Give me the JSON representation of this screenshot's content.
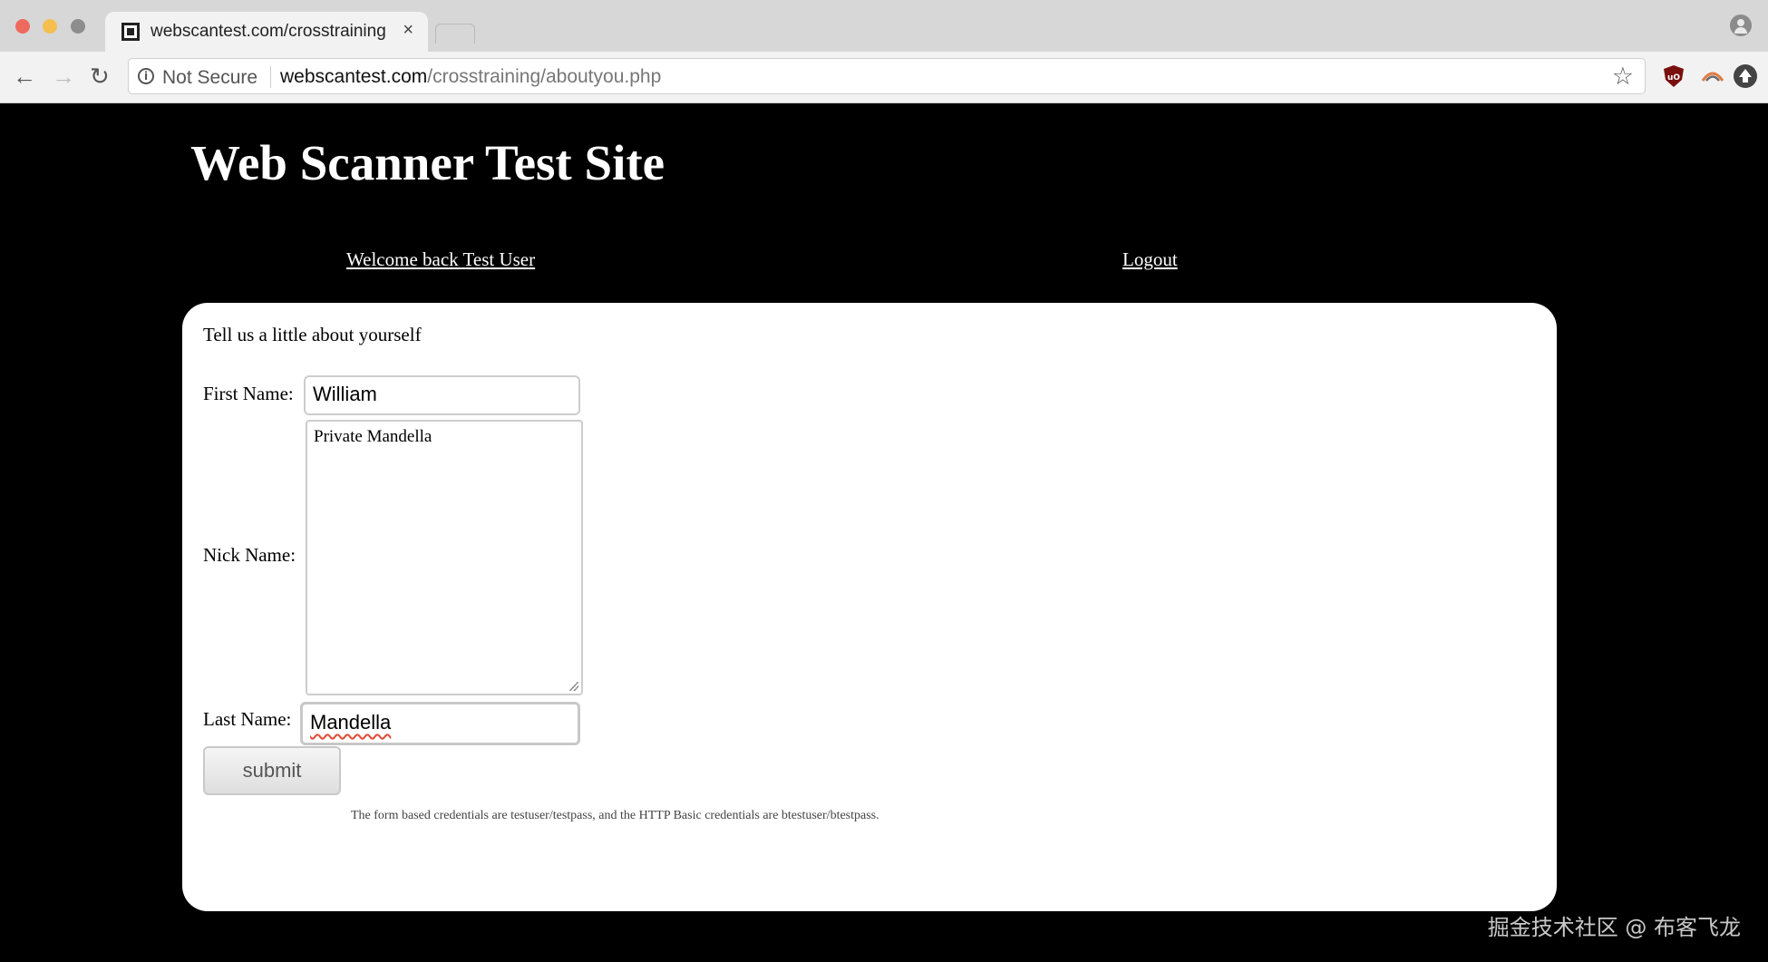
{
  "browser": {
    "tab_title": "webscantest.com/crosstraining",
    "tab_close": "×",
    "security_label": "Not Secure",
    "url_host": "webscantest.com",
    "url_path": "/crosstraining/aboutyou.php",
    "nav": {
      "back": "←",
      "forward": "→",
      "reload": "↻"
    },
    "star": "☆"
  },
  "site": {
    "title": "Web Scanner Test Site",
    "welcome_link": "Welcome back Test User",
    "logout_link": "Logout"
  },
  "form": {
    "intro": "Tell us a little about yourself",
    "first_name_label": "First Name:",
    "first_name_value": "William",
    "nick_name_label": "Nick Name:",
    "nick_name_value": "Private Mandella",
    "last_name_label": "Last Name:",
    "last_name_value": "Mandella",
    "submit_label": "submit",
    "note": "The form based credentials are testuser/testpass, and the HTTP Basic credentials are btestuser/btestpass."
  },
  "watermark": "掘金技术社区 @ 布客飞龙",
  "icons": [
    "favicon-icon",
    "close-icon",
    "back-icon",
    "forward-icon",
    "reload-icon",
    "info-icon",
    "star-icon",
    "ublock-icon",
    "arc-extension-icon",
    "upload-extension-icon",
    "profile-icon"
  ]
}
